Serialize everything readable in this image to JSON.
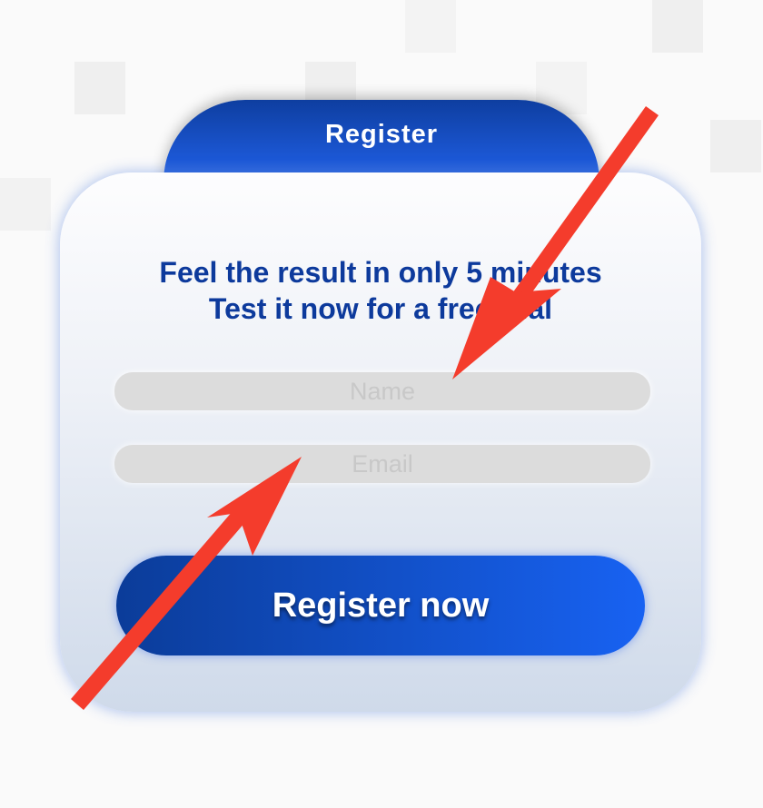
{
  "tab": {
    "label": "Register"
  },
  "headline": {
    "line1": "Feel the result in only 5 minutes",
    "line2": "Test it now for a free trial"
  },
  "form": {
    "name_placeholder": "Name",
    "email_placeholder": "Email",
    "submit_label": "Register now"
  },
  "annotations": {
    "arrow_color": "#f43c2c",
    "arrows": [
      "arrow-pointing-to-name-field",
      "arrow-pointing-to-email-field"
    ]
  },
  "colors": {
    "primary": "#0d3a9c",
    "button_end": "#1862f2"
  }
}
